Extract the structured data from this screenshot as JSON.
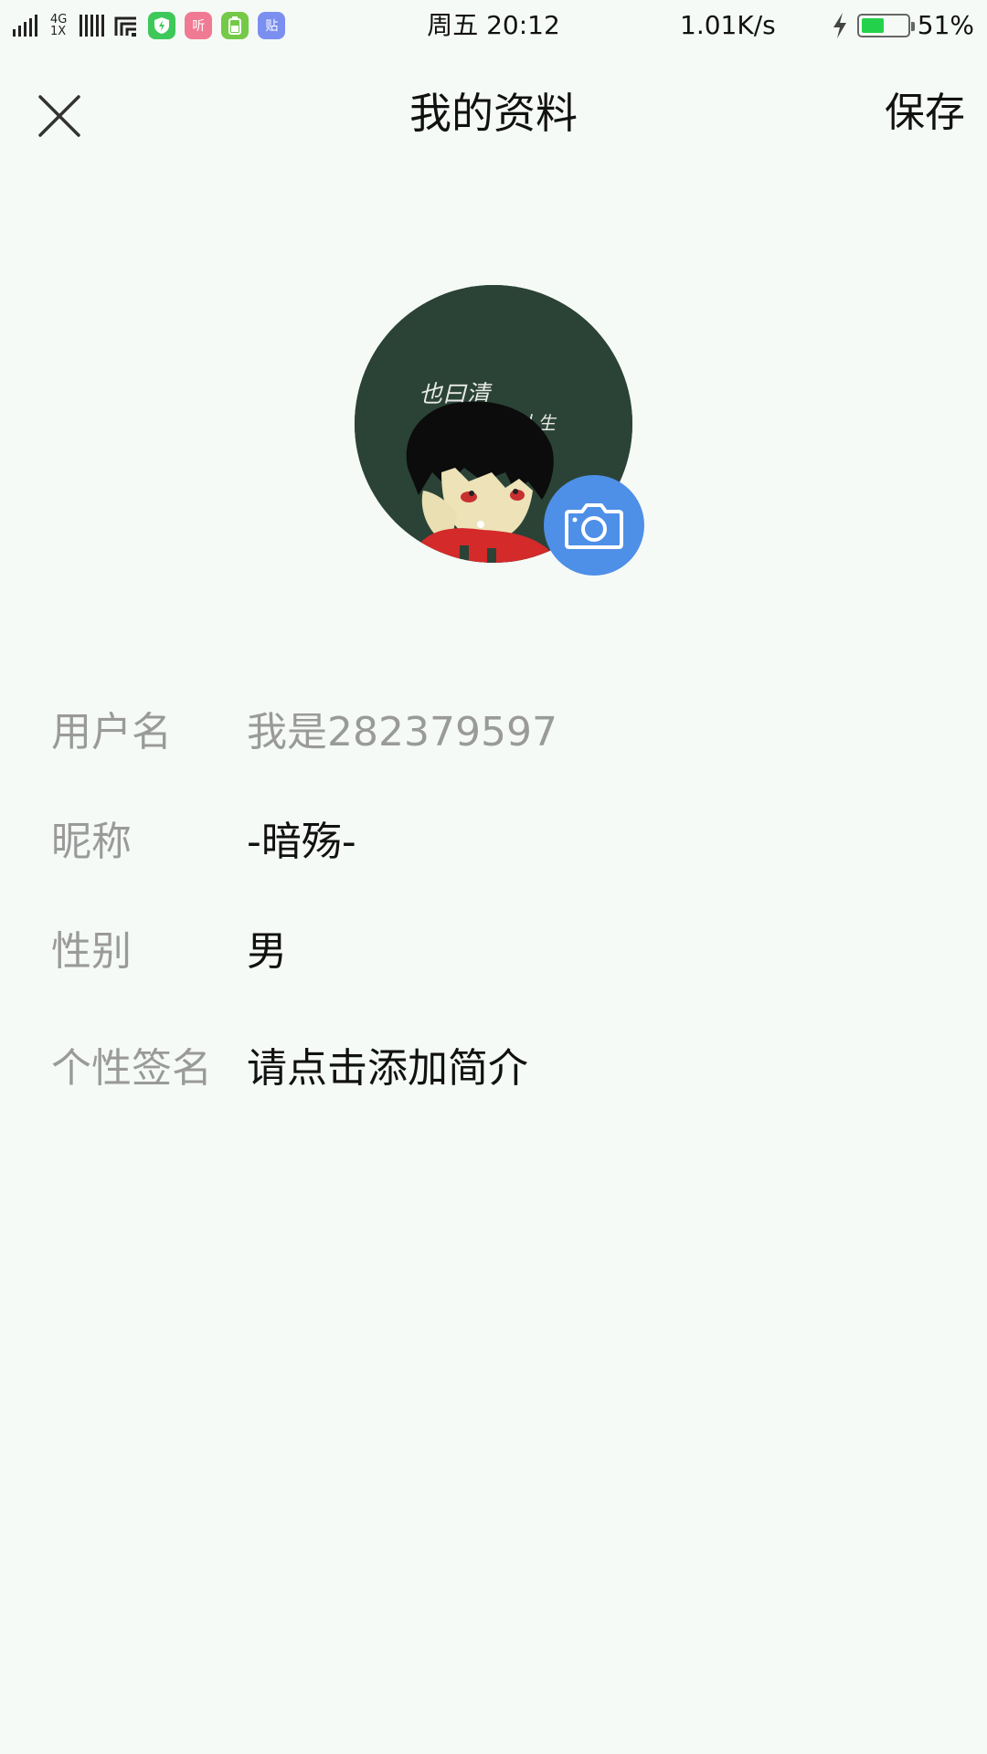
{
  "status_bar": {
    "network_type_top": "4G",
    "network_type_bottom": "1X",
    "app_icons": [
      {
        "name": "shield-app-icon",
        "glyph": "⚡",
        "color": "#3ec85a"
      },
      {
        "name": "listen-app-icon",
        "glyph": "听",
        "color": "#f07a93"
      },
      {
        "name": "battery-app-icon",
        "glyph": "▮",
        "color": "#74c947"
      },
      {
        "name": "tieba-app-icon",
        "glyph": "贴",
        "color": "#7b8ff0"
      }
    ],
    "time": "周五  20:12",
    "net_speed": "1.01K/s",
    "battery_level": 0.51,
    "battery_text": "51%",
    "battery_fill_color": "#23d24a"
  },
  "navbar": {
    "title": "我的资料",
    "save_label": "保存"
  },
  "avatar": {
    "caption_line1": "也曰清",
    "caption_line2": "加入你的人生",
    "camera_button_color": "#4e8fe8"
  },
  "profile": {
    "username_label": "用户名",
    "username_value": "我是282379597",
    "nickname_label": "昵称",
    "nickname_value": "-暗殇-",
    "gender_label": "性别",
    "gender_value": "男",
    "signature_label": "个性签名",
    "signature_value": "请点击添加简介"
  }
}
